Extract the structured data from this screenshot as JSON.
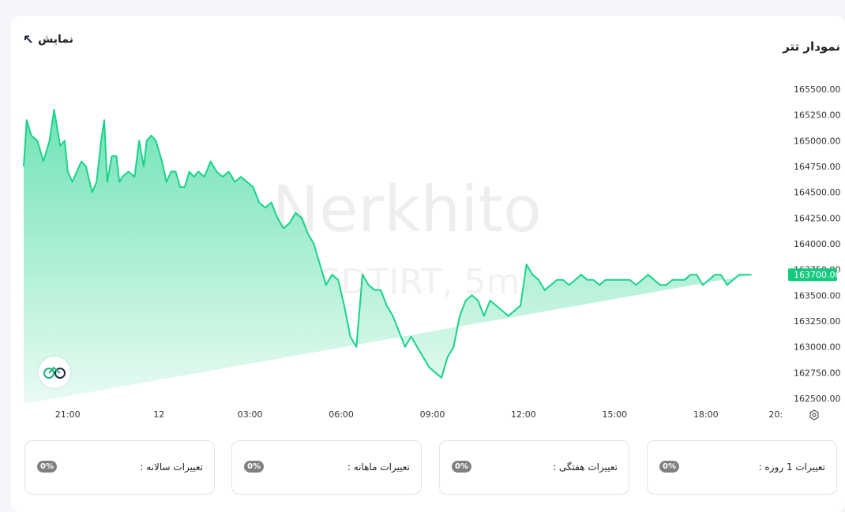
{
  "header": {
    "title": "نمودار تتر",
    "show_label": "نمایش"
  },
  "watermark": {
    "brand": "Nerkhito",
    "symbol": "USDTIRT, 5m"
  },
  "current_price": "163700.00",
  "colors": {
    "line": "#19d38a",
    "area_top": "#6fe3b5",
    "area_bottom": "#eafbf3",
    "price_tag": "#12c97d"
  },
  "chart_data": {
    "type": "area",
    "symbol": "USDTIRT",
    "interval": "5m",
    "ylim": [
      162500,
      165500
    ],
    "y_ticks": [
      "165500.00",
      "165250.00",
      "165000.00",
      "164750.00",
      "164500.00",
      "164250.00",
      "164000.00",
      "163750.00",
      "163500.00",
      "163250.00",
      "163000.00",
      "162750.00",
      "162500.00"
    ],
    "x_ticks": [
      "21:00",
      "12",
      "03:00",
      "06:00",
      "09:00",
      "12:00",
      "15:00",
      "18:00",
      "20:"
    ],
    "x_tick_hours": [
      21,
      24,
      27,
      30,
      33,
      36,
      39,
      42,
      44.3
    ],
    "x_range_hours": [
      19.55,
      43.8
    ],
    "grid": false,
    "series": [
      {
        "x_hours": [
          19.55,
          19.65,
          19.8,
          20.0,
          20.2,
          20.4,
          20.55,
          20.75,
          20.9,
          21.0,
          21.15,
          21.3,
          21.45,
          21.6,
          21.8,
          21.95,
          22.1,
          22.2,
          22.3,
          22.45,
          22.6,
          22.7,
          22.8,
          23.0,
          23.2,
          23.35,
          23.5,
          23.6,
          23.75,
          23.9,
          24.1,
          24.25,
          24.4,
          24.55,
          24.7,
          24.85,
          25.0,
          25.15,
          25.3,
          25.5,
          25.7,
          25.9,
          26.1,
          26.3,
          26.5,
          26.7,
          26.9,
          27.1,
          27.3,
          27.5,
          27.7,
          27.9,
          28.1,
          28.3,
          28.5,
          28.7,
          28.9,
          29.1,
          29.3,
          29.5,
          29.7,
          29.9,
          30.1,
          30.3,
          30.5,
          30.7,
          30.9,
          31.1,
          31.3,
          31.5,
          31.7,
          31.9,
          32.1,
          32.3,
          32.5,
          32.7,
          32.9,
          33.1,
          33.3,
          33.5,
          33.7,
          33.9,
          34.1,
          34.3,
          34.5,
          34.7,
          34.9,
          35.1,
          35.3,
          35.5,
          35.7,
          35.9,
          36.1,
          36.3,
          36.5,
          36.7,
          36.9,
          37.1,
          37.3,
          37.5,
          37.7,
          37.9,
          38.1,
          38.3,
          38.5,
          38.7,
          38.9,
          39.1,
          39.3,
          39.5,
          39.7,
          39.9,
          40.1,
          40.3,
          40.5,
          40.7,
          40.9,
          41.1,
          41.3,
          41.5,
          41.7,
          41.9,
          42.1,
          42.3,
          42.5,
          42.7,
          42.9,
          43.1,
          43.3,
          43.5,
          43.8
        ],
        "values": [
          164750,
          165200,
          165050,
          165000,
          164800,
          165000,
          165300,
          164950,
          165000,
          164700,
          164600,
          164700,
          164800,
          164750,
          164500,
          164600,
          165000,
          165200,
          164600,
          164850,
          164850,
          164600,
          164650,
          164700,
          164650,
          165000,
          164750,
          165000,
          165050,
          165000,
          164800,
          164600,
          164700,
          164700,
          164550,
          164550,
          164700,
          164650,
          164700,
          164650,
          164800,
          164700,
          164650,
          164700,
          164600,
          164650,
          164600,
          164550,
          164400,
          164350,
          164400,
          164250,
          164150,
          164200,
          164300,
          164250,
          164100,
          164000,
          163800,
          163600,
          163700,
          163650,
          163400,
          163100,
          163000,
          163700,
          163600,
          163550,
          163550,
          163400,
          163300,
          163150,
          163000,
          163100,
          163000,
          162900,
          162800,
          162750,
          162700,
          162900,
          163000,
          163300,
          163450,
          163500,
          163450,
          163300,
          163450,
          163400,
          163350,
          163300,
          163350,
          163400,
          163800,
          163700,
          163650,
          163550,
          163600,
          163650,
          163650,
          163600,
          163650,
          163700,
          163650,
          163650,
          163600,
          163650,
          163650,
          163650,
          163650,
          163650,
          163600,
          163650,
          163700,
          163650,
          163600,
          163600,
          163650,
          163650,
          163650,
          163700,
          163700,
          163600,
          163650,
          163700,
          163700,
          163600,
          163650,
          163700,
          163700,
          163700
        ]
      }
    ]
  },
  "stats": [
    {
      "label": "تعییرات 1 روزه :",
      "value": "0%"
    },
    {
      "label": "تعییرات هفتگی :",
      "value": "0%"
    },
    {
      "label": "تعییرات ماهانه :",
      "value": "0%"
    },
    {
      "label": "تعییرات سالانه :",
      "value": "0%"
    }
  ]
}
